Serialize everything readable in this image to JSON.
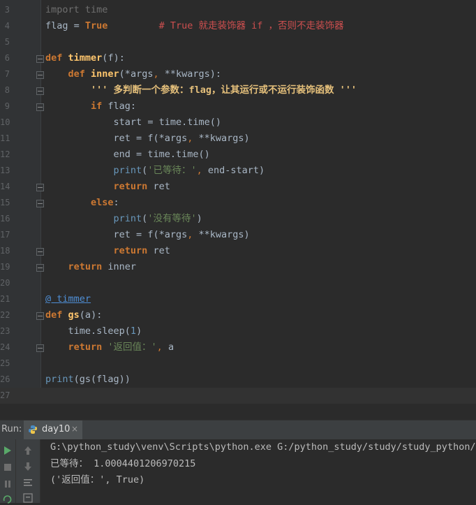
{
  "editor": {
    "lines": [
      {
        "num": "3",
        "tokens": [
          {
            "t": "import",
            "c": "muted kwl"
          },
          {
            "t": " time",
            "c": "muted"
          }
        ]
      },
      {
        "num": "4",
        "tokens": [
          {
            "t": "flag ",
            "c": ""
          },
          {
            "t": "=",
            "c": ""
          },
          {
            "t": " True",
            "c": "kw"
          },
          {
            "t": "         # True 就走装饰器 if ，否则不走装饰器",
            "c": "cmt"
          }
        ]
      },
      {
        "num": "5",
        "tokens": []
      },
      {
        "num": "6",
        "tokens": [
          {
            "t": "def ",
            "c": "kw"
          },
          {
            "t": "timmer",
            "c": "fn"
          },
          {
            "t": "(",
            "c": ""
          },
          {
            "t": "f",
            "c": ""
          },
          {
            "t": "):",
            "c": ""
          }
        ]
      },
      {
        "num": "7",
        "tokens": [
          {
            "t": "    def ",
            "c": "kw"
          },
          {
            "t": "inner",
            "c": "fn"
          },
          {
            "t": "(*",
            "c": ""
          },
          {
            "t": "args",
            "c": ""
          },
          {
            "t": ", ",
            "c": "kwl"
          },
          {
            "t": "**",
            "c": ""
          },
          {
            "t": "kwargs",
            "c": ""
          },
          {
            "t": "):",
            "c": ""
          }
        ]
      },
      {
        "num": "8",
        "tokens": [
          {
            "t": "        ''' 多判断一个参数：flag，让其运行或不运行装饰函数 '''",
            "c": "docstr"
          }
        ]
      },
      {
        "num": "9",
        "tokens": [
          {
            "t": "        if ",
            "c": "kw"
          },
          {
            "t": "flag:",
            "c": ""
          }
        ]
      },
      {
        "num": "10",
        "tokens": [
          {
            "t": "            start ",
            "c": ""
          },
          {
            "t": "=",
            "c": ""
          },
          {
            "t": " time.time()",
            "c": ""
          }
        ]
      },
      {
        "num": "11",
        "tokens": [
          {
            "t": "            ret ",
            "c": ""
          },
          {
            "t": "=",
            "c": ""
          },
          {
            "t": " f(*args",
            "c": ""
          },
          {
            "t": ", ",
            "c": "kwl"
          },
          {
            "t": "**kwargs)",
            "c": ""
          }
        ]
      },
      {
        "num": "12",
        "tokens": [
          {
            "t": "            end ",
            "c": ""
          },
          {
            "t": "=",
            "c": ""
          },
          {
            "t": " time.time()",
            "c": ""
          }
        ]
      },
      {
        "num": "13",
        "tokens": [
          {
            "t": "            print",
            "c": "num"
          },
          {
            "t": "(",
            "c": ""
          },
          {
            "t": "'已等待：'",
            "c": "str"
          },
          {
            "t": ", ",
            "c": "kwl"
          },
          {
            "t": "end",
            "c": ""
          },
          {
            "t": "-",
            "c": ""
          },
          {
            "t": "start)",
            "c": ""
          }
        ]
      },
      {
        "num": "14",
        "tokens": [
          {
            "t": "            return ",
            "c": "kw"
          },
          {
            "t": "ret",
            "c": ""
          }
        ]
      },
      {
        "num": "15",
        "tokens": [
          {
            "t": "        else",
            "c": "kw"
          },
          {
            "t": ":",
            "c": ""
          }
        ]
      },
      {
        "num": "16",
        "tokens": [
          {
            "t": "            print",
            "c": "num"
          },
          {
            "t": "(",
            "c": ""
          },
          {
            "t": "'没有等待'",
            "c": "str"
          },
          {
            "t": ")",
            "c": ""
          }
        ]
      },
      {
        "num": "17",
        "tokens": [
          {
            "t": "            ret ",
            "c": ""
          },
          {
            "t": "=",
            "c": ""
          },
          {
            "t": " f(*args",
            "c": ""
          },
          {
            "t": ", ",
            "c": "kwl"
          },
          {
            "t": "**kwargs)",
            "c": ""
          }
        ]
      },
      {
        "num": "18",
        "tokens": [
          {
            "t": "            return ",
            "c": "kw"
          },
          {
            "t": "ret",
            "c": ""
          }
        ]
      },
      {
        "num": "19",
        "tokens": [
          {
            "t": "    return ",
            "c": "kw"
          },
          {
            "t": "inner",
            "c": ""
          }
        ]
      },
      {
        "num": "20",
        "tokens": []
      },
      {
        "num": "21",
        "tokens": [
          {
            "t": "@ timmer",
            "c": "deco"
          }
        ]
      },
      {
        "num": "22",
        "tokens": [
          {
            "t": "def ",
            "c": "kw"
          },
          {
            "t": "gs",
            "c": "fn"
          },
          {
            "t": "(",
            "c": ""
          },
          {
            "t": "a",
            "c": ""
          },
          {
            "t": "):",
            "c": ""
          }
        ]
      },
      {
        "num": "23",
        "tokens": [
          {
            "t": "    time.sleep(",
            "c": ""
          },
          {
            "t": "1",
            "c": "num"
          },
          {
            "t": ")",
            "c": ""
          }
        ]
      },
      {
        "num": "24",
        "tokens": [
          {
            "t": "    return ",
            "c": "kw"
          },
          {
            "t": "'返回值：'",
            "c": "str"
          },
          {
            "t": ", ",
            "c": "kwl"
          },
          {
            "t": "a",
            "c": ""
          }
        ]
      },
      {
        "num": "25",
        "tokens": []
      },
      {
        "num": "26",
        "tokens": [
          {
            "t": "print",
            "c": "num"
          },
          {
            "t": "(gs(flag))",
            "c": ""
          }
        ]
      },
      {
        "num": "27",
        "tokens": [],
        "current": true
      }
    ]
  },
  "run_panel": {
    "label": "Run:",
    "tab_label": "day10",
    "tab_close": "×",
    "output": [
      "G:\\python_study\\venv\\Scripts\\python.exe G:/python_study/study/study_python/da",
      "已等待： 1.0004401206970215",
      "('返回值：', True)"
    ]
  },
  "colors": {
    "background": "#2b2b2b",
    "keyword": "#cc7832",
    "function": "#ffc66d",
    "string": "#6a8759",
    "comment": "#cd4f4f",
    "run_icon": "#59a869"
  },
  "icons": [
    "run-icon",
    "stop-icon",
    "pause-icon",
    "up-arrow-icon",
    "down-arrow-icon",
    "rerun-icon",
    "python-file-icon",
    "close-icon"
  ]
}
